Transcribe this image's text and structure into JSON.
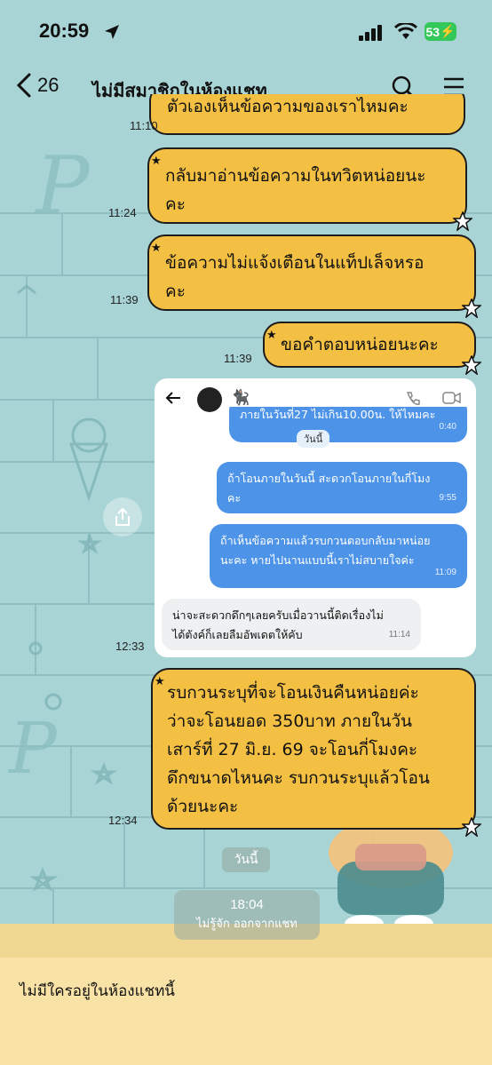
{
  "status_bar": {
    "time": "20:59",
    "battery": "53"
  },
  "header": {
    "back_count": "26",
    "title": "ไม่มีสมาชิกในห้องแชท"
  },
  "messages": [
    {
      "text": "ตัวเองเห็นข้อความของเราไหมคะ",
      "time": "11:10"
    },
    {
      "text_line1": "กลับมาอ่านข้อความในทวิตหน่อยนะ",
      "text_line2": "คะ",
      "time": "11:24"
    },
    {
      "text_line1": "ข้อความไม่แจ้งเตือนในแท็ปเล็จหรอ",
      "text_line2": "คะ",
      "time": "11:39"
    },
    {
      "text": "ขอคำตอบหน่อยนะคะ",
      "time": "11:39"
    },
    {
      "time": "12:33"
    },
    {
      "lines": [
        "รบกวนระบุที่จะโอนเงินคืนหน่อยค่ะ",
        "ว่าจะโอนยอด 350บาท ภายในวัน",
        "เสาร์ที่ 27 มิ.ย. 69 จะโอนกี่โมงคะ",
        "ดึกขนาดไหนคะ รบกวนระบุแล้วโอน",
        "ด้วยนะคะ"
      ],
      "time": "12:34"
    }
  ],
  "screenshot": {
    "top_cut_text": "ภายในวันที่27 ไม่เกิน10.00น. ให้ไหมคะ",
    "date_chip": "วันนี้",
    "first_time": "0:40",
    "bubbles": [
      {
        "lines": [
          "ถ้าโอนภายในวันนี้ สะดวกโอนภายในกี่โมง",
          "คะ"
        ],
        "time": "9:55"
      },
      {
        "lines": [
          "ถ้าเห็นข้อความแล้วรบกวนตอบกลับมาหน่อย",
          "นะคะ หายไปนานแบบนี้เราไม่สบายใจค่ะ"
        ],
        "time": "11:09"
      }
    ],
    "reply": {
      "lines": [
        "น่าจะสะดวกดึกๆเลยครับเมื่อวานนี้ติดเรื่องไม่",
        "ได้ตังค์ก็เลยลืมอัพเดตให้คับ"
      ],
      "time": "11:14"
    }
  },
  "day_chip": "วันนี้",
  "system_message": {
    "time": "18:04",
    "text": "ไม่รู้จัก ออกจากแชท"
  },
  "footer": {
    "text": "ไม่มีใครอยู่ในห้องแชทนี้"
  }
}
